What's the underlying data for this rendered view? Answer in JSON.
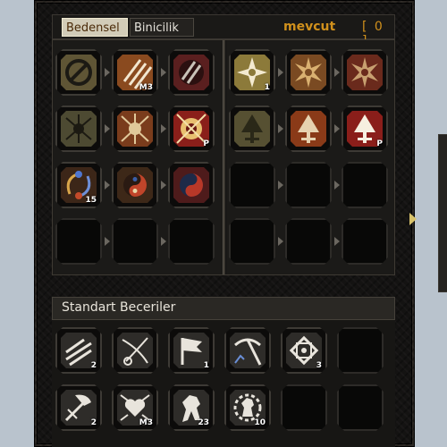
{
  "tabs": {
    "bedensel": "Bedensel",
    "binicilik": "Binicilik"
  },
  "points": {
    "label": "mevcut",
    "value": "[ 0 ]"
  },
  "skills_left": [
    {
      "icon": "slash-ring-icon",
      "badge": "",
      "bg": "#5f5535"
    },
    {
      "icon": "claw-slash-icon",
      "badge": "M3",
      "bg": "#8a4a1f"
    },
    {
      "icon": "triple-slash-icon",
      "badge": "",
      "bg": "#5a1f1f"
    },
    {
      "icon": "spider-icon",
      "badge": "",
      "bg": "#4d4a32"
    },
    {
      "icon": "spider-burst-icon",
      "badge": "",
      "bg": "#7a3c1c"
    },
    {
      "icon": "spider-sun-icon",
      "badge": "P",
      "bg": "#8a1f1a"
    },
    {
      "icon": "orbs-icon",
      "badge": "15",
      "bg": "#3c2618"
    },
    {
      "icon": "yin-yang-icon",
      "badge": "",
      "bg": "#3d2818"
    },
    {
      "icon": "spiral-icon",
      "badge": "",
      "bg": "#4e1b1b"
    }
  ],
  "skills_right": [
    {
      "icon": "star-burst-icon",
      "badge": "1",
      "bg": "#8c7a3a"
    },
    {
      "icon": "sun-wheel-icon",
      "badge": "",
      "bg": "#7a4a22"
    },
    {
      "icon": "sun-flare-icon",
      "badge": "",
      "bg": "#6a2a1c"
    },
    {
      "icon": "sword-tree-icon",
      "badge": "",
      "bg": "#565032"
    },
    {
      "icon": "sword-tree-red-icon",
      "badge": "",
      "bg": "#8a3a18"
    },
    {
      "icon": "sword-tree-white-icon",
      "badge": "P",
      "bg": "#8a1e1a"
    }
  ],
  "standard": {
    "title": "Standart Beceriler",
    "skills": [
      {
        "icon": "charge-icon",
        "badge": "2"
      },
      {
        "icon": "whip-icon",
        "badge": ""
      },
      {
        "icon": "flag-icon",
        "badge": "1"
      },
      {
        "icon": "pickaxe-icon",
        "badge": ""
      },
      {
        "icon": "knot-icon",
        "badge": "3"
      },
      {
        "icon": "dash-icon",
        "badge": "2"
      },
      {
        "icon": "heart-icon",
        "badge": "M3"
      },
      {
        "icon": "horse-icon",
        "badge": "23"
      },
      {
        "icon": "horse-circle-icon",
        "badge": "10"
      }
    ]
  }
}
